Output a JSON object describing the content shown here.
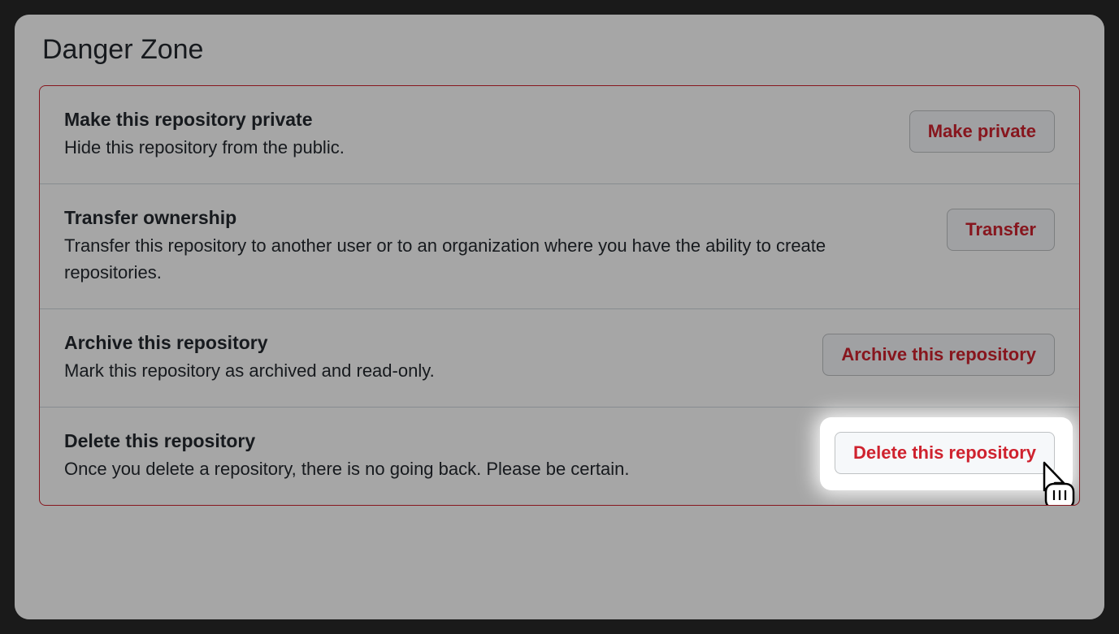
{
  "section_title": "Danger Zone",
  "rows": [
    {
      "title": "Make this repository private",
      "desc": "Hide this repository from the public.",
      "button": "Make private"
    },
    {
      "title": "Transfer ownership",
      "desc": "Transfer this repository to another user or to an organization where you have the ability to create repositories.",
      "button": "Transfer"
    },
    {
      "title": "Archive this repository",
      "desc": "Mark this repository as archived and read-only.",
      "button": "Archive this repository"
    },
    {
      "title": "Delete this repository",
      "desc": "Once you delete a repository, there is no going back. Please be certain.",
      "button": "Delete this repository"
    }
  ]
}
